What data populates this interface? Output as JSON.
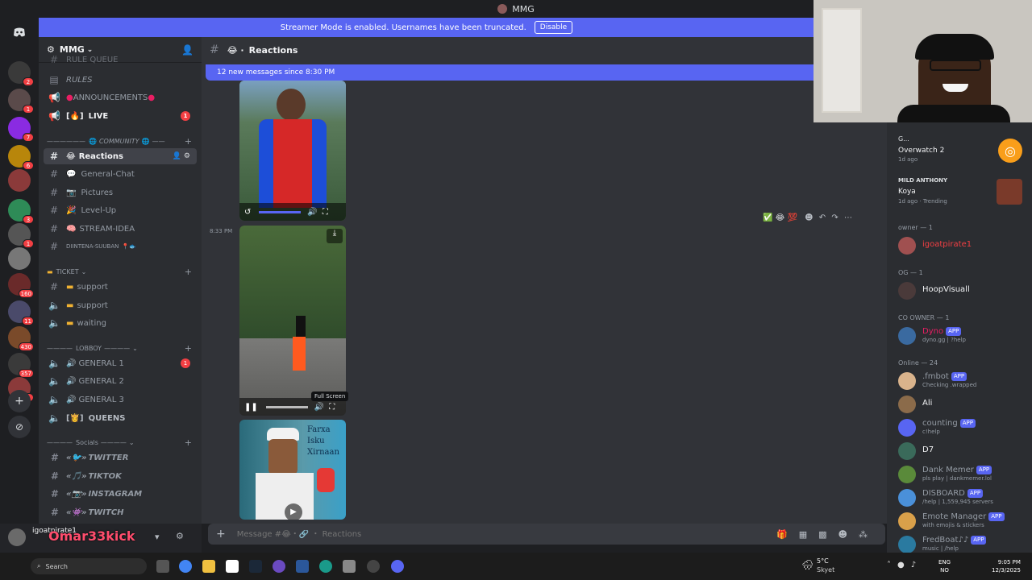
{
  "window": {
    "title": "MMG"
  },
  "banner": {
    "text": "Streamer Mode is enabled. Usernames have been truncated.",
    "button": "Disable"
  },
  "server": {
    "name": "MMG"
  },
  "servers": [
    {
      "badge": "2",
      "color": "#3a3a3a"
    },
    {
      "badge": "1",
      "color": "#5a4a4a"
    },
    {
      "badge": "7",
      "color": "#8a2be2"
    },
    {
      "badge": "6",
      "color": "#b8860b"
    },
    {
      "badge": "",
      "color": "#8b3a3a"
    },
    {
      "badge": "3",
      "color": "#2e8b57"
    },
    {
      "badge": "1",
      "color": "#555555"
    },
    {
      "badge": "",
      "color": "#777777"
    },
    {
      "badge": "160",
      "color": "#6a2a2a"
    },
    {
      "badge": "11",
      "color": "#4a4a6a"
    },
    {
      "badge": "430",
      "color": "#7a4a2a"
    },
    {
      "badge": "357",
      "color": "#3a3a3a"
    },
    {
      "badge": "2",
      "color": "#8b3a3a"
    }
  ],
  "channels": {
    "truncated_top": "RULE QUEUE",
    "rules": "RULES",
    "announcements": "ANNOUNCEMENTS",
    "live": "LIVE",
    "live_badge": "1",
    "cat_community": "COMMUNITY",
    "reactions": "Reactions",
    "general_chat": "General-Chat",
    "pictures": "Pictures",
    "level_up": "Level-Up",
    "stream_idea": "STREAM-IDEA",
    "diintena": "DIINTENA-SUUBAN",
    "cat_ticket": "TICKET",
    "support1": "support",
    "support2": "support",
    "waiting": "waiting",
    "cat_lobby": "LOBBOY",
    "general1": "GENERAL 1",
    "general1_badge": "1",
    "general2": "GENERAL 2",
    "general3": "GENERAL 3",
    "queens": "QUEENS",
    "cat_socials": "Socials",
    "twitter": "TWITTER",
    "tiktok": "TIKTOK",
    "instagram": "INSTAGRAM",
    "twitch": "TWITCH"
  },
  "user": {
    "name": "igoatpirate1",
    "overlay": "Omar33kick"
  },
  "chat": {
    "channel": "Reactions",
    "new_messages": "12 new messages since 8:30 PM",
    "timestamp": "8:33 PM",
    "tooltip": "Full Screen",
    "video3_text1": "Farxa",
    "video3_text2": "Isku",
    "video3_text3": "Xirnaan",
    "placeholder": "Message #😂・🔗 ・ Reactions"
  },
  "activity": [
    {
      "name": "G...",
      "game": "Overwatch 2",
      "time": "1d ago"
    },
    {
      "name": "MILD ANTHONY",
      "game": "Koya",
      "time": "1d ago",
      "extra": "Trending"
    }
  ],
  "members": {
    "owner_header": "owner — 1",
    "owner": "igoatpirate1",
    "og_header": "OG — 1",
    "og": "HoopVisuall",
    "coowner_header": "CO OWNER — 1",
    "coowner": "Dyno",
    "coowner_status": "dyno.gg | ?help",
    "online_header": "Online — 24",
    "list": [
      {
        "name": ".fmbot",
        "app": "APP",
        "status": "Checking .wrapped",
        "color": "#d9b38c"
      },
      {
        "name": "Ali",
        "app": "",
        "status": "",
        "color": "#8b6b4a"
      },
      {
        "name": "counting",
        "app": "APP",
        "status": "c!help",
        "color": "#5865f2"
      },
      {
        "name": "D7",
        "app": "",
        "status": "",
        "color": "#3a6a5a"
      },
      {
        "name": "Dank Memer",
        "app": "APP",
        "status": "pls play | dankmemer.lol",
        "color": "#5a8a3a"
      },
      {
        "name": "DISBOARD",
        "app": "APP",
        "status": "/help | 1,559,945 servers",
        "color": "#4a90d9"
      },
      {
        "name": "Emote Manager",
        "app": "APP",
        "status": "with emojis & stickers",
        "color": "#d9a04a"
      },
      {
        "name": "FredBoat♪♪",
        "app": "APP",
        "status": "music | /help",
        "color": "#2a7aa0"
      }
    ],
    "app_label": "APP"
  },
  "taskbar": {
    "search": "Search",
    "weather_temp": "5°C",
    "weather_desc": "Skyet",
    "lang1": "ENG",
    "lang2": "NO",
    "time": "9:05 PM",
    "date": "12/3/2025"
  },
  "colors": {
    "accent": "#5865f2",
    "danger": "#f23f43",
    "online": "#23a55a"
  }
}
